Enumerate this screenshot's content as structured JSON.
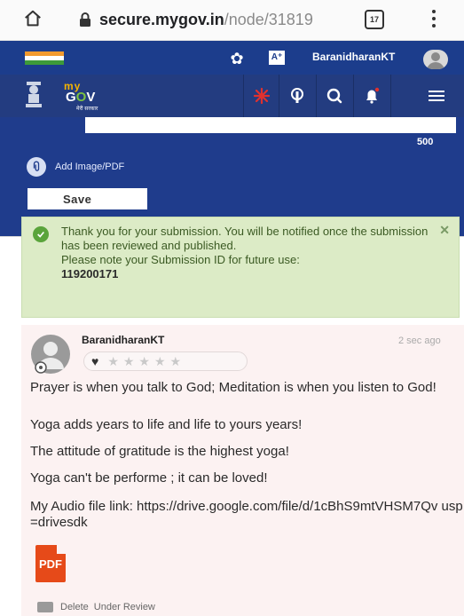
{
  "browser": {
    "url_host": "secure.mygov.in",
    "url_path": "/node/31819",
    "tab_count": "17"
  },
  "top_strip": {
    "username": "BaranidharanKT"
  },
  "nav": {
    "logo_my": "my",
    "logo_gov_1": "G",
    "logo_gov_2": "O",
    "logo_gov_3": "V",
    "logo_sub": "मेरी सरकार"
  },
  "form": {
    "char_count": "500",
    "add_image_label": "Add Image/PDF",
    "save_label": "Save"
  },
  "alert": {
    "message": "Thank you for your submission. You will be notified once the submission has been reviewed and published.",
    "note": "Please note your Submission ID for future use:",
    "submission_id": "119200171"
  },
  "comment": {
    "author": "BaranidharanKT",
    "time": "2 sec ago",
    "lines": [
      "Prayer is when you talk to God; Meditation is when you listen to God!",
      "Yoga adds years to life and life to yours years!",
      "The attitude of gratitude is the highest yoga!",
      "Yoga can't be performe ; it can be loved!",
      "My Audio file link: https://drive.google.com/file/d/1cBhS9mtVHSM7Qv usp=drivesdk"
    ],
    "pdf_label": "PDF",
    "delete_label": "Delete",
    "status_label": "Under Review"
  },
  "colors": {
    "header_blue": "#1c3d8c",
    "alert_green": "#dcebc6",
    "comment_bg": "#fcf2f2"
  }
}
